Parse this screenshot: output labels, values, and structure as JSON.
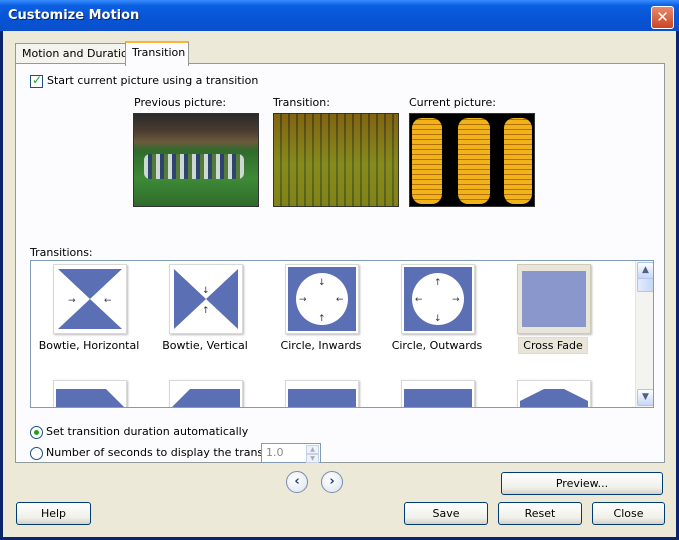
{
  "window": {
    "title": "Customize Motion",
    "close_glyph": "✕"
  },
  "tabs": [
    {
      "label": "Motion and Duration",
      "active": false
    },
    {
      "label": "Transition",
      "active": true
    }
  ],
  "start_transition": {
    "label": "Start current picture using a transition",
    "checked": true
  },
  "previews": {
    "previous_label": "Previous picture:",
    "transition_label": "Transition:",
    "current_label": "Current picture:"
  },
  "transitions": {
    "label": "Transitions:",
    "items": [
      {
        "name": "Bowtie, Horizontal",
        "selected": false
      },
      {
        "name": "Bowtie, Vertical",
        "selected": false
      },
      {
        "name": "Circle, Inwards",
        "selected": false
      },
      {
        "name": "Circle, Outwards",
        "selected": false
      },
      {
        "name": "Cross Fade",
        "selected": true
      }
    ]
  },
  "duration": {
    "auto_label": "Set transition duration automatically",
    "auto_selected": true,
    "seconds_label": "Number of seconds to display the transition",
    "seconds_value": "1.0"
  },
  "nav": {
    "prev_glyph": "‹",
    "next_glyph": "›"
  },
  "buttons": {
    "preview": "Preview...",
    "help": "Help",
    "save": "Save",
    "reset": "Reset",
    "close": "Close"
  },
  "colors": {
    "accent_blue": "#5b6fb4",
    "titlebar": "#0854d6"
  }
}
